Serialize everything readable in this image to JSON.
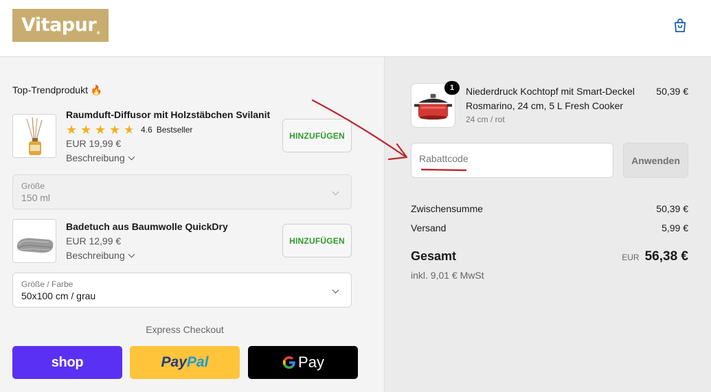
{
  "brand": {
    "name": "Vitapur",
    "mark": "®"
  },
  "header": {
    "cart_icon": "shopping-bag-icon"
  },
  "upsell": {
    "title": "Top-Trendprodukt 🔥",
    "products": [
      {
        "name": "Raumduft-Diffusor mit Holzstäbchen Svilanit",
        "rating": "4.6",
        "rating_value": 4.6,
        "badge": "Bestseller",
        "price": "EUR 19,99 €",
        "description_label": "Beschreibung",
        "add_label": "HINZUFÜGEN",
        "variant_label": "Größe",
        "variant_value": "150 ml"
      },
      {
        "name": "Badetuch aus Baumwolle QuickDry",
        "price": "EUR 12,99 €",
        "description_label": "Beschreibung",
        "add_label": "HINZUFÜGEN",
        "variant_label": "Größe / Farbe",
        "variant_value": "50x100 cm / grau"
      }
    ],
    "express_label": "Express Checkout",
    "shop_pay_label": "shop",
    "paypal_part1": "Pay",
    "paypal_part2": "Pal",
    "gpay_label": "Pay"
  },
  "cart": {
    "item": {
      "quantity": "1",
      "name": "Niederdruck Kochtopf mit Smart-Deckel Rosmarino, 24 cm, 5 L Fresh Cooker",
      "variant": "24 cm / rot",
      "price": "50,39 €"
    },
    "discount_placeholder": "Rabattcode",
    "apply_label": "Anwenden",
    "subtotal_label": "Zwischensumme",
    "subtotal_value": "50,39 €",
    "shipping_label": "Versand",
    "shipping_value": "5,99 €",
    "total_label": "Gesamt",
    "total_currency": "EUR",
    "total_value": "56,38 €",
    "tax_note": "inkl. 9,01 € MwSt"
  },
  "colors": {
    "brand": "#c9ad70",
    "add_button_text": "#2e9a2e",
    "shop_pay": "#5a31f4",
    "paypal": "#ffc439",
    "annotation": "#c0262c"
  }
}
